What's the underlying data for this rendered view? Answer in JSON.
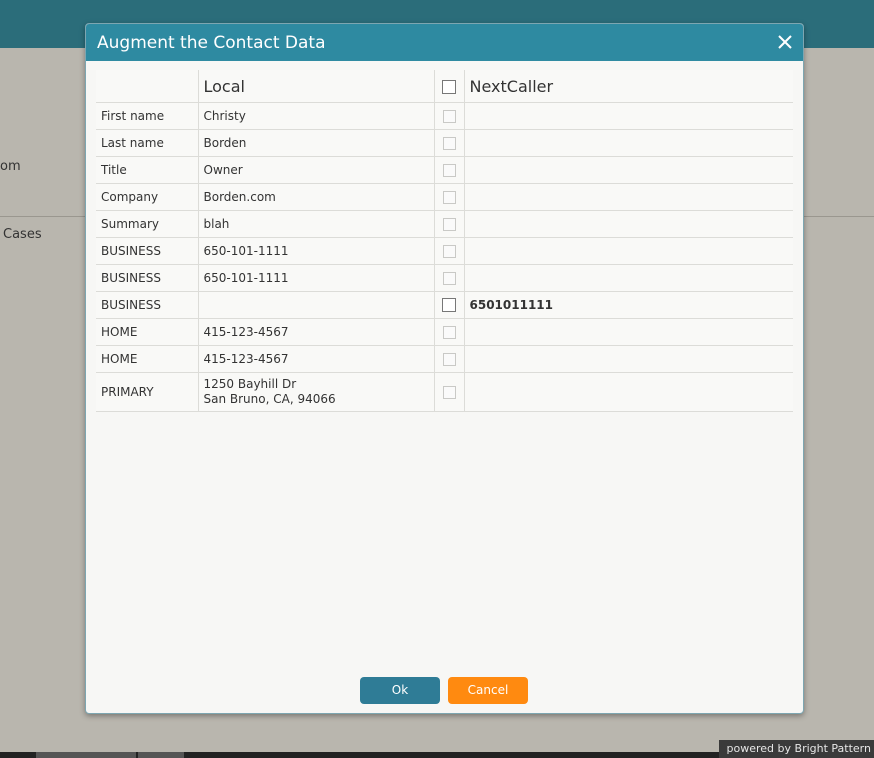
{
  "background": {
    "partial_text_1": "om",
    "partial_text_2": "Cases",
    "powered_by": "powered by Bright Pattern"
  },
  "dialog": {
    "title": "Augment the Contact Data",
    "columns": {
      "local": "Local",
      "remote": "NextCaller"
    },
    "rows": [
      {
        "label": "First name",
        "local": "Christy",
        "remote": "",
        "checkbox_enabled": false
      },
      {
        "label": "Last name",
        "local": "Borden",
        "remote": "",
        "checkbox_enabled": false
      },
      {
        "label": "Title",
        "local": "Owner",
        "remote": "",
        "checkbox_enabled": false
      },
      {
        "label": "Company",
        "local": "Borden.com",
        "remote": "",
        "checkbox_enabled": false
      },
      {
        "label": "Summary",
        "local": "blah",
        "remote": "",
        "checkbox_enabled": false
      },
      {
        "label": "BUSINESS",
        "local": "650-101-1111",
        "remote": "",
        "checkbox_enabled": false
      },
      {
        "label": "BUSINESS",
        "local": "650-101-1111",
        "remote": "",
        "checkbox_enabled": false
      },
      {
        "label": "BUSINESS",
        "local": "",
        "remote": "6501011111",
        "checkbox_enabled": true
      },
      {
        "label": "HOME",
        "local": "415-123-4567",
        "remote": "",
        "checkbox_enabled": false
      },
      {
        "label": "HOME",
        "local": "415-123-4567",
        "remote": "",
        "checkbox_enabled": false
      },
      {
        "label": "PRIMARY",
        "local_line1": "1250 Bayhill Dr",
        "local_line2": "San Bruno, CA, 94066",
        "remote": "",
        "checkbox_enabled": false
      }
    ],
    "ok_label": "Ok",
    "cancel_label": "Cancel"
  },
  "colors": {
    "header": "#2e8aa1",
    "ok_button": "#2f7c96",
    "cancel_button": "#ff8a10",
    "topbar": "#2b6d7a"
  }
}
